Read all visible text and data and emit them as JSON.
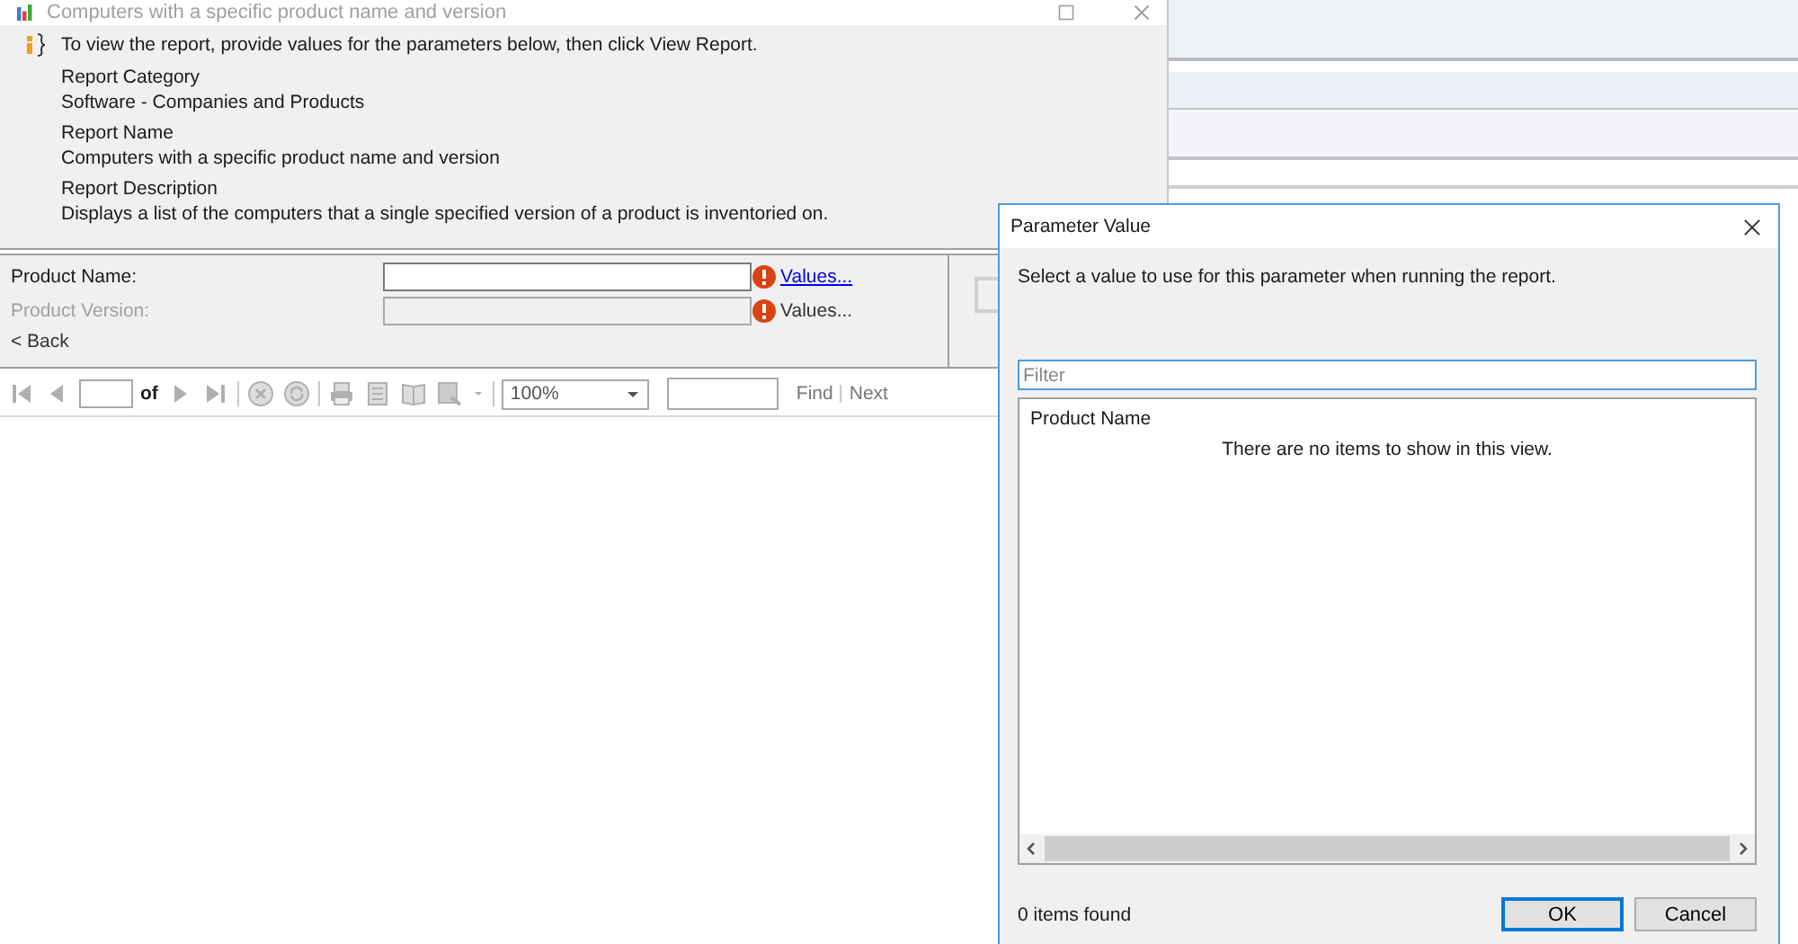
{
  "main_window": {
    "title": "Computers with a specific product name and version",
    "info": {
      "prompt": "To view the report, provide values for the parameters below, then click View Report.",
      "fields": [
        {
          "label": "Report Category",
          "value": "Software - Companies and Products"
        },
        {
          "label": "Report Name",
          "value": "Computers with a specific product name and version"
        },
        {
          "label": "Report Description",
          "value": "Displays a list of the computers that a single specified version of a product is inventoried on."
        }
      ]
    },
    "parameters": [
      {
        "label": "Product Name:",
        "disabled": false,
        "values_link": "Values..."
      },
      {
        "label": "Product Version:",
        "disabled": true,
        "values_link": "Values..."
      }
    ],
    "back_link": "< Back",
    "toolbar": {
      "of_label": "of",
      "zoom": "100%",
      "find": "Find",
      "next": "Next"
    }
  },
  "dialog": {
    "title": "Parameter Value",
    "instruction": "Select a value to use for this parameter when running the report.",
    "filter_placeholder": "Filter",
    "list": {
      "column": "Product Name",
      "empty_message": "There are no items to show in this view."
    },
    "status": "0 items found",
    "buttons": [
      {
        "label": "OK",
        "default": true
      },
      {
        "label": "Cancel",
        "default": false
      }
    ]
  }
}
